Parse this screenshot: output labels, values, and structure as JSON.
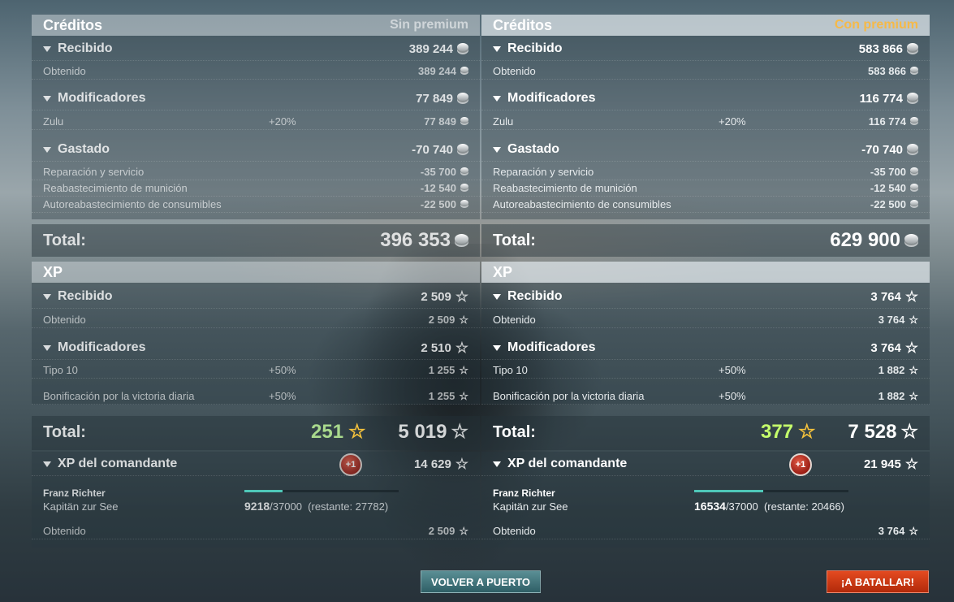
{
  "left": {
    "credits": {
      "title": "Créditos",
      "premium_label": "Sin premium",
      "received": {
        "label": "Recibido",
        "value": "389 244"
      },
      "earned": {
        "label": "Obtenido",
        "value": "389 244"
      },
      "modifiers": {
        "label": "Modificadores",
        "value": "77 849"
      },
      "zulu": {
        "label": "Zulu",
        "pct": "+20%",
        "value": "77 849"
      },
      "spent": {
        "label": "Gastado",
        "value": "-70 740"
      },
      "repair": {
        "label": "Reparación y servicio",
        "value": "-35 700"
      },
      "ammo": {
        "label": "Reabastecimiento de munición",
        "value": "-12 540"
      },
      "consumables": {
        "label": "Autoreabastecimiento de consumibles",
        "value": "-22 500"
      },
      "total": {
        "label": "Total:",
        "value": "396 353"
      }
    },
    "xp": {
      "title": "XP",
      "received": {
        "label": "Recibido",
        "value": "2 509"
      },
      "earned": {
        "label": "Obtenido",
        "value": "2 509"
      },
      "modifiers": {
        "label": "Modificadores",
        "value": "2 510"
      },
      "tipo10": {
        "label": "Tipo 10",
        "pct": "+50%",
        "value": "1 255"
      },
      "daily": {
        "label": "Bonificación por la victoria diaria",
        "pct": "+50%",
        "value": "1 255"
      },
      "total": {
        "label": "Total:",
        "small": "251",
        "value": "5 019"
      }
    },
    "commander": {
      "label": "XP del comandante",
      "badge": "+1",
      "value": "14 629",
      "name": "Franz Richter",
      "rank": "Kapitän zur See",
      "current": "9218",
      "max": "/37000",
      "remaining": "(restante: 27782)",
      "progress": 0.249,
      "earned": {
        "label": "Obtenido",
        "value": "2 509"
      }
    }
  },
  "right": {
    "credits": {
      "title": "Créditos",
      "premium_label": "Con premium",
      "received": {
        "label": "Recibido",
        "value": "583 866"
      },
      "earned": {
        "label": "Obtenido",
        "value": "583 866"
      },
      "modifiers": {
        "label": "Modificadores",
        "value": "116 774"
      },
      "zulu": {
        "label": "Zulu",
        "pct": "+20%",
        "value": "116 774"
      },
      "spent": {
        "label": "Gastado",
        "value": "-70 740"
      },
      "repair": {
        "label": "Reparación y servicio",
        "value": "-35 700"
      },
      "ammo": {
        "label": "Reabastecimiento de munición",
        "value": "-12 540"
      },
      "consumables": {
        "label": "Autoreabastecimiento de consumibles",
        "value": "-22 500"
      },
      "total": {
        "label": "Total:",
        "value": "629 900"
      }
    },
    "xp": {
      "title": "XP",
      "received": {
        "label": "Recibido",
        "value": "3 764"
      },
      "earned": {
        "label": "Obtenido",
        "value": "3 764"
      },
      "modifiers": {
        "label": "Modificadores",
        "value": "3 764"
      },
      "tipo10": {
        "label": "Tipo 10",
        "pct": "+50%",
        "value": "1 882"
      },
      "daily": {
        "label": "Bonificación por la victoria diaria",
        "pct": "+50%",
        "value": "1 882"
      },
      "total": {
        "label": "Total:",
        "small": "377",
        "value": "7 528"
      }
    },
    "commander": {
      "label": "XP del comandante",
      "badge": "+1",
      "value": "21 945",
      "name": "Franz Richter",
      "rank": "Kapitän zur See",
      "current": "16534",
      "max": "/37000",
      "remaining": "(restante: 20466)",
      "progress": 0.447,
      "earned": {
        "label": "Obtenido",
        "value": "3 764"
      }
    }
  },
  "buttons": {
    "port": "VOLVER A PUERTO",
    "battle": "¡A BATALLAR!"
  },
  "icons": {
    "credit": "silver-coin-stack-icon",
    "xp": "star-outline-icon"
  },
  "colors": {
    "premium": "#f5b948",
    "xp_small_right": "#c5ff6b",
    "xp_small_left": "#a9d98d",
    "battle_button": "#d63a14",
    "port_button": "#3f7278",
    "progress_fill": "#4fc7b8"
  }
}
